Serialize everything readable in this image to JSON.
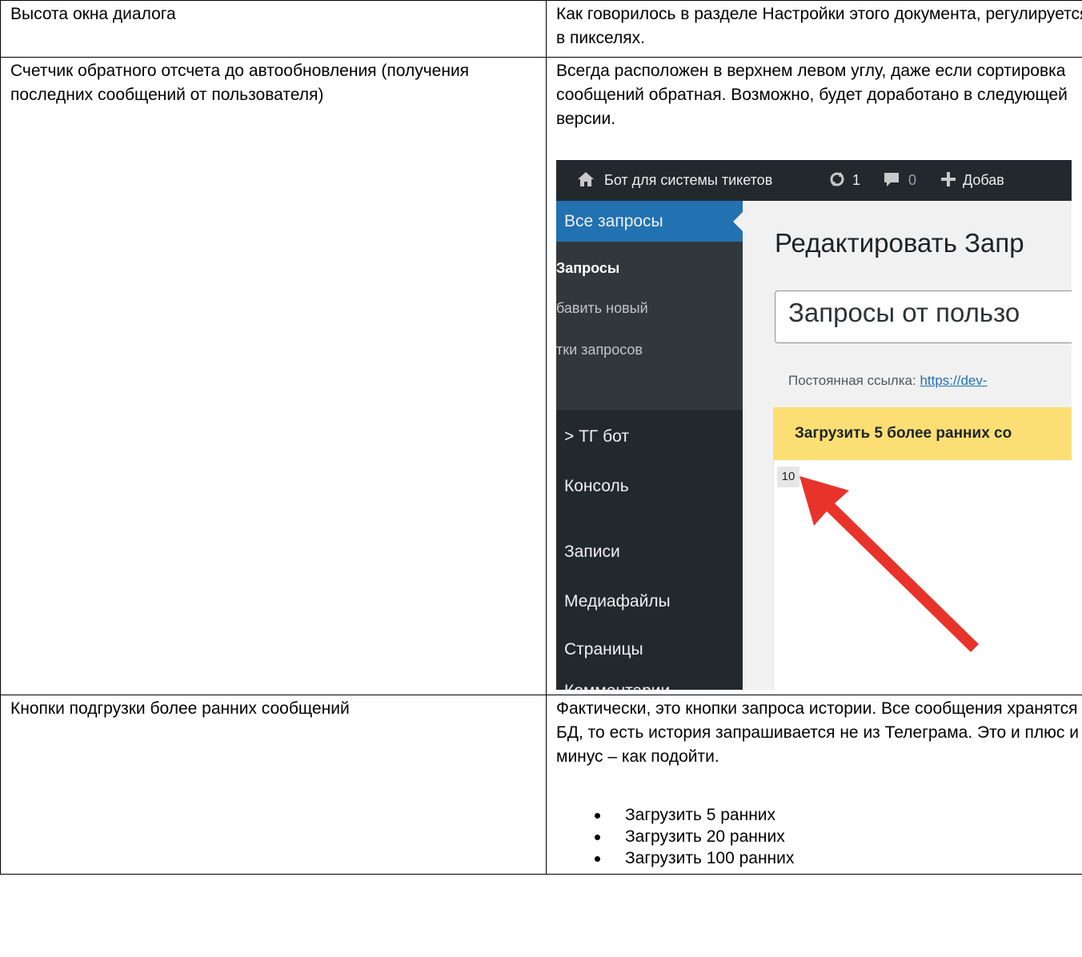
{
  "rows": [
    {
      "label": "Высота окна диалога",
      "description": "Как говорилось в разделе Настройки этого документа, регулируется в пикселях."
    },
    {
      "label": "Счетчик обратного отсчета до автообновления (получения последних сообщений от пользователя)",
      "description": "Всегда расположен в верхнем левом углу, даже если сортировка сообщений обратная. Возможно, будет доработано в следующей версии."
    },
    {
      "label": "Кнопки подгрузки более ранних сообщений",
      "description": "Фактически, это кнопки запроса истории. Все сообщения хранятся в БД, то есть история запрашивается не из Телеграма. Это и плюс и минус – как подойти.",
      "bullets": [
        "Загрузить 5 ранних",
        "Загрузить 20 ранних",
        "Загрузить 100 ранних"
      ]
    }
  ],
  "screenshot": {
    "admin_bar": {
      "site_name": "Бот для системы тикетов",
      "updates_count": "1",
      "comments_count": "0",
      "add_new": "Добав"
    },
    "sidebar": {
      "active_item": "Все запросы",
      "submenu": [
        "Запросы",
        "бавить новый",
        "тки запросов"
      ],
      "items": [
        "> ТГ бот",
        "Консоль",
        "Записи",
        "Медиафайлы",
        "Страницы",
        "Комментарии"
      ]
    },
    "page_title": "Редактировать Запр",
    "post_title": "Запросы от пользо",
    "permalink_label": "Постоянная ссылка:",
    "permalink_url": "https://dev-",
    "load_button": "Загрузить 5 более ранних со",
    "countdown": "10",
    "colors": {
      "admin_bg": "#23282d",
      "active": "#2271b1",
      "notice": "#fbdf74",
      "arrow": "#e8332a"
    }
  }
}
